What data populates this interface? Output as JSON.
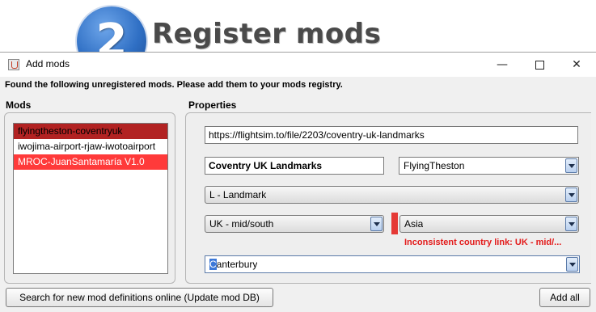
{
  "banner": {
    "step_number": "2",
    "title": "Register mods"
  },
  "window": {
    "title": "Add mods",
    "controls": {
      "minimize": "—",
      "close": "✕"
    }
  },
  "notice": "Found the following unregistered mods. Please add them to your mods registry.",
  "mods": {
    "label": "Mods",
    "items": [
      {
        "label": "flyingtheston-coventryuk",
        "state": "selected"
      },
      {
        "label": "iwojima-airport-rjaw-iwotoairport",
        "state": "normal"
      },
      {
        "label": "MROC-JuanSantamaría V1.0",
        "state": "error"
      }
    ]
  },
  "properties": {
    "label": "Properties",
    "url": "https://flightsim.to/file/2203/coventry-uk-landmarks",
    "name": "Coventry UK Landmarks",
    "author": "FlyingTheston",
    "category": "L - Landmark",
    "country": "UK  - mid/south",
    "continent": "Asia",
    "warning": "Inconsistent country link: UK  - mid/...",
    "city_selected_part": "C",
    "city_rest": "anterbury"
  },
  "buttons": {
    "search": "Search for new mod definitions online (Update mod DB)",
    "add_all": "Add all"
  },
  "colors": {
    "selected_row": "#b22222",
    "error_row": "#ff3a3a",
    "warning_text": "#e31b1b",
    "badge_blue": "#2f6fc4"
  }
}
